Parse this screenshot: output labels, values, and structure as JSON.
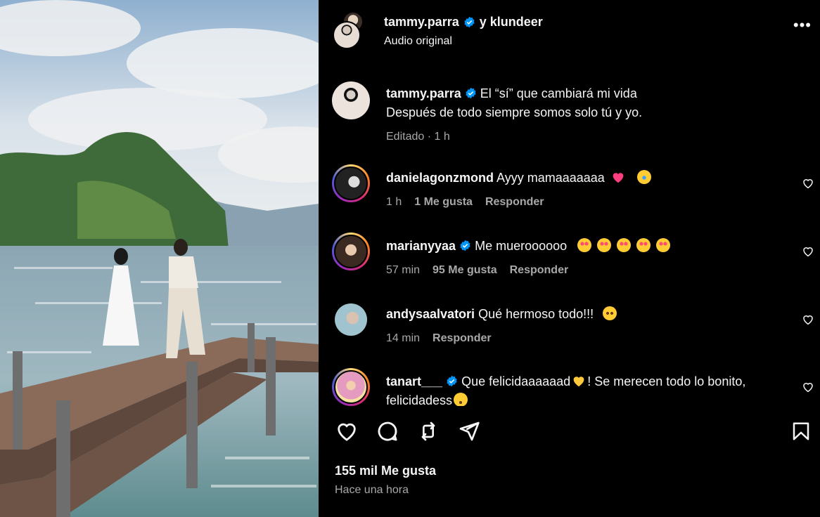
{
  "post_header": {
    "username": "tammy.parra",
    "collab_text": "y klundeer",
    "audio": "Audio original",
    "more_label": "•••"
  },
  "caption": {
    "username": "tammy.parra",
    "line1": "El “sí” que cambiará mi vida",
    "line2": "Después de todo siempre somos solo tú y yo.",
    "meta": "Editado · 1 h"
  },
  "comments": [
    {
      "username": "danielagonzmond",
      "text": "Ayyy mamaaaaaaa",
      "time": "1 h",
      "likes": "1 Me gusta",
      "reply": "Responder",
      "verified": false
    },
    {
      "username": "marianyyaa",
      "text": "Me mueroooooo",
      "time": "57 min",
      "likes": "95 Me gusta",
      "reply": "Responder",
      "verified": true
    },
    {
      "username": "andysaalvatori",
      "text": "Qué hermoso todo!!!",
      "time": "14 min",
      "likes": "",
      "reply": "Responder",
      "verified": false
    },
    {
      "username": "tanart___",
      "text_a": "Que felicidaaaaaad",
      "text_b": "! Se merecen todo lo bonito,",
      "text_c": "felicidadess",
      "verified": true
    }
  ],
  "footer": {
    "likes": "155 mil Me gusta",
    "time": "Hace una hora"
  },
  "colors": {
    "verified": "#0095f6",
    "muted": "#a8a8a8",
    "background": "#000000"
  },
  "icons": [
    "heart-icon",
    "comment-icon",
    "repost-icon",
    "share-icon",
    "bookmark-icon",
    "more-icon",
    "verified-icon"
  ]
}
